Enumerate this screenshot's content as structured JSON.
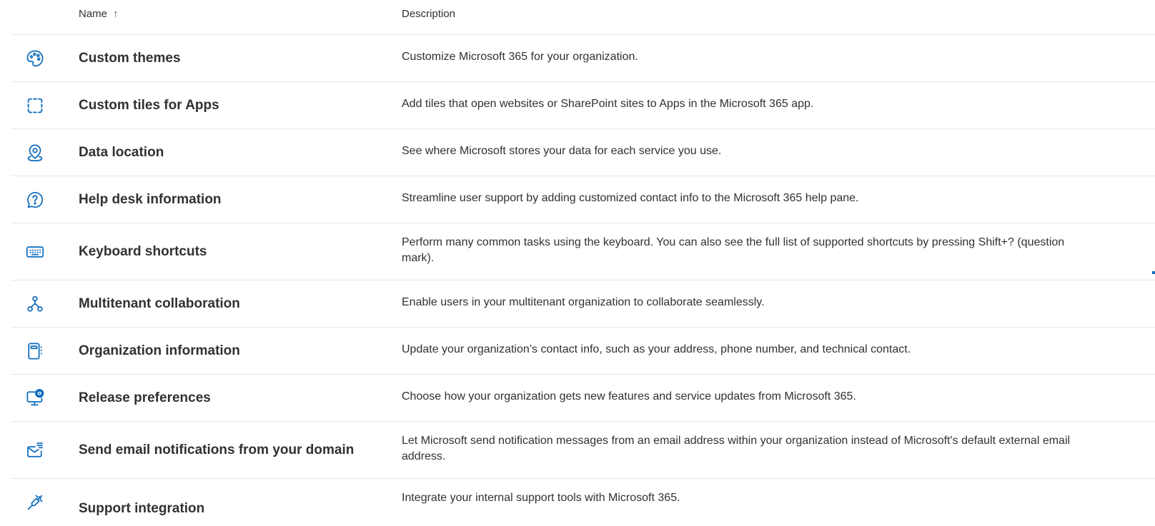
{
  "table": {
    "columns": {
      "name_label": "Name",
      "name_sort_indicator": "↑",
      "description_label": "Description"
    },
    "rows": [
      {
        "icon": "palette-icon",
        "name": "Custom themes",
        "description": "Customize Microsoft 365 for your organization."
      },
      {
        "icon": "dashed-square-icon",
        "name": "Custom tiles for Apps",
        "description": "Add tiles that open websites or SharePoint sites to Apps in the Microsoft 365 app."
      },
      {
        "icon": "location-pin-icon",
        "name": "Data location",
        "description": "See where Microsoft stores your data for each service you use."
      },
      {
        "icon": "help-chat-icon",
        "name": "Help desk information",
        "description": "Streamline user support by adding customized contact info to the Microsoft 365 help pane."
      },
      {
        "icon": "keyboard-icon",
        "name": "Keyboard shortcuts",
        "description": "Perform many common tasks using the keyboard. You can also see the full list of supported shortcuts by pressing Shift+? (question mark)."
      },
      {
        "icon": "org-network-icon",
        "name": "Multitenant collaboration",
        "description": "Enable users in your multitenant organization to collaborate seamlessly."
      },
      {
        "icon": "org-info-icon",
        "name": "Organization information",
        "description": "Update your organization’s contact info, such as your address, phone number, and technical contact."
      },
      {
        "icon": "desktop-update-icon",
        "name": "Release preferences",
        "description": "Choose how your organization gets new features and service updates from Microsoft 365."
      },
      {
        "icon": "mail-notification-icon",
        "name": "Send email notifications from your domain",
        "description": "Let Microsoft send notification messages from an email address within your organization instead of Microsoft's default external email address."
      },
      {
        "icon": "plug-icon",
        "name": "Support integration",
        "description": "Integrate your internal support tools with Microsoft 365."
      }
    ]
  },
  "colors": {
    "icon": "#0f6cbd",
    "text": "#323130",
    "divider": "#e6e6e6"
  }
}
